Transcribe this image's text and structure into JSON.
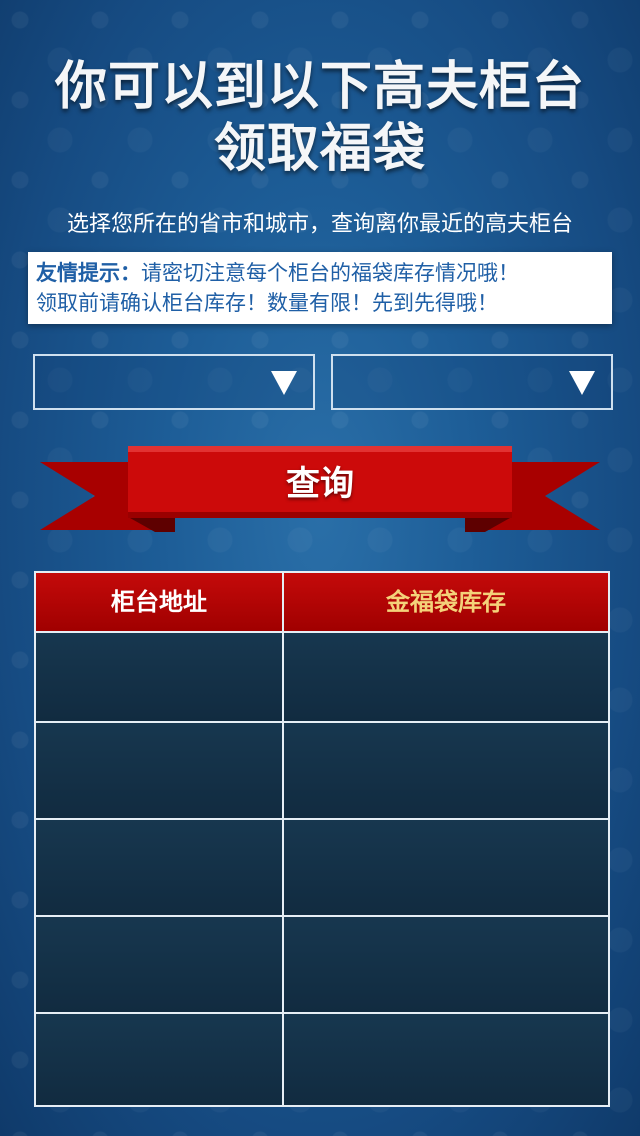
{
  "header": {
    "title_line1": "你可以到以下高夫柜台",
    "title_line2": "领取福袋",
    "subtitle": "选择您所在的省市和城市，查询离你最近的高夫柜台"
  },
  "notice": {
    "label": "友情提示：",
    "line1_text": "请密切注意每个柜台的福袋库存情况哦！",
    "line2_text": "领取前请确认柜台库存！数量有限！先到先得哦！"
  },
  "filters": {
    "province_select": {
      "value": ""
    },
    "city_select": {
      "value": ""
    }
  },
  "actions": {
    "query_label": "查询"
  },
  "results_table": {
    "columns": [
      "柜台地址",
      "金福袋库存"
    ],
    "rows": [
      [
        "",
        ""
      ],
      [
        "",
        ""
      ],
      [
        "",
        ""
      ],
      [
        "",
        ""
      ],
      [
        "",
        ""
      ]
    ]
  },
  "colors": {
    "background": "#1d5d97",
    "ribbon_red": "#c40a0a",
    "header_gold": "#f4d27a",
    "notice_blue": "#1f5fa6",
    "table_cell": "#17374f"
  },
  "icons": {
    "select_arrow": "triangle-down-icon"
  }
}
